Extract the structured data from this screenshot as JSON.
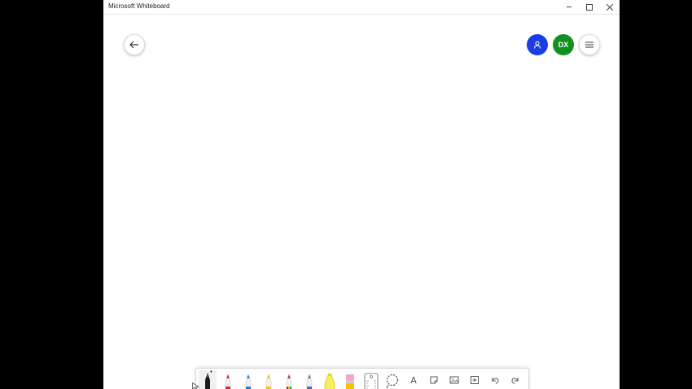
{
  "window": {
    "title": "Microsoft Whiteboard"
  },
  "header": {
    "back_icon": "arrow-left-icon",
    "share_icon": "person-icon",
    "avatar_initials": "DX",
    "menu_icon": "hamburger-menu-icon"
  },
  "colors": {
    "share_button": "#1a3de6",
    "avatar": "#138f1f",
    "pen_black": "#1a1a1a",
    "pen_red": "#e0203a",
    "pen_blue": "#1f7fd6",
    "pen_yellow": "#f4c400",
    "highlighter_yellow": "#f6ee5a",
    "eraser_pink": "#f3a4d0"
  },
  "toolbar": {
    "tools": [
      {
        "name": "pen-black",
        "icon": "pen-icon",
        "selected": true
      },
      {
        "name": "pen-red",
        "icon": "pen-icon"
      },
      {
        "name": "pen-blue",
        "icon": "pen-icon"
      },
      {
        "name": "pen-yellow",
        "icon": "pen-icon"
      },
      {
        "name": "pen-rainbow",
        "icon": "pen-icon"
      },
      {
        "name": "pen-galaxy",
        "icon": "pen-icon"
      },
      {
        "name": "highlighter",
        "icon": "highlighter-icon"
      },
      {
        "name": "eraser",
        "icon": "eraser-icon"
      },
      {
        "name": "ruler",
        "icon": "ruler-icon"
      },
      {
        "name": "lasso",
        "icon": "lasso-icon"
      },
      {
        "name": "text",
        "icon": "text-icon",
        "label": "A"
      },
      {
        "name": "sticky-note",
        "icon": "sticky-note-icon"
      },
      {
        "name": "image",
        "icon": "image-icon"
      },
      {
        "name": "insert",
        "icon": "add-icon"
      },
      {
        "name": "undo",
        "icon": "undo-icon"
      },
      {
        "name": "redo",
        "icon": "redo-icon"
      }
    ]
  }
}
